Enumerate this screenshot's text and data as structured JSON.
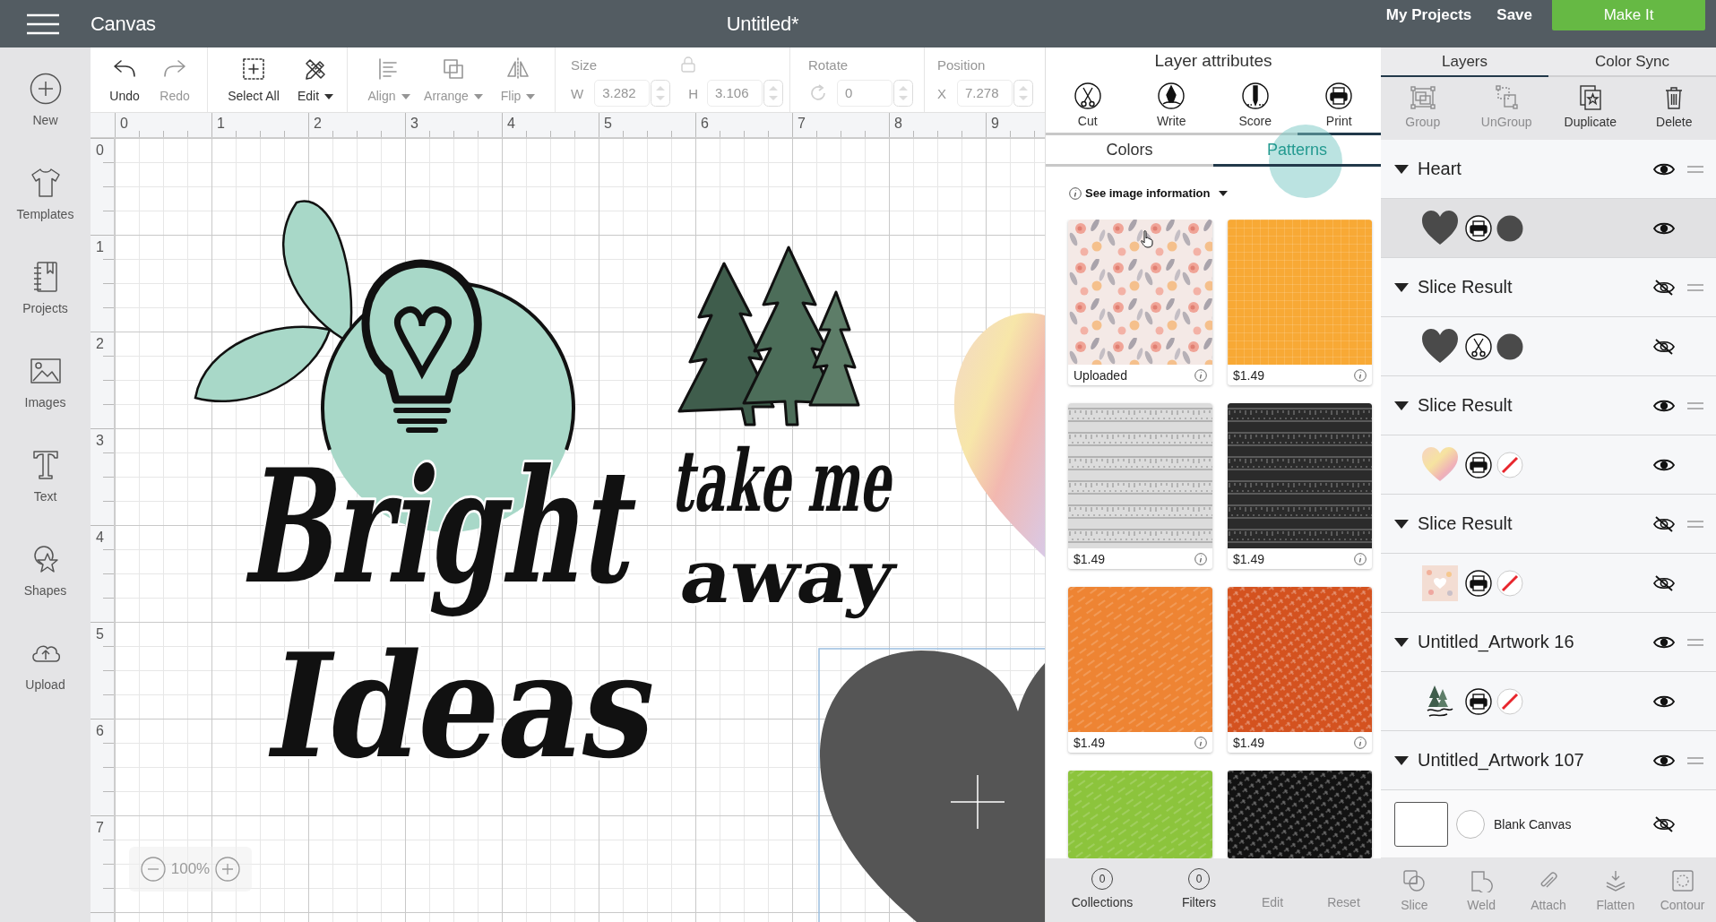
{
  "top_bar": {
    "app_title": "Canvas",
    "document_title": "Untitled*",
    "links": [
      "My Projects",
      "Save"
    ],
    "primary_button": "Make It"
  },
  "sidebar": {
    "items": [
      {
        "label": "New"
      },
      {
        "label": "Templates"
      },
      {
        "label": "Projects"
      },
      {
        "label": "Images"
      },
      {
        "label": "Text"
      },
      {
        "label": "Shapes"
      },
      {
        "label": "Upload"
      }
    ]
  },
  "toolbar": {
    "groups": [
      {
        "buttons": [
          {
            "label": "Undo",
            "disabled": false,
            "dropdown": false
          },
          {
            "label": "Redo",
            "disabled": true,
            "dropdown": false
          }
        ]
      },
      {
        "buttons": [
          {
            "label": "Select All",
            "disabled": false,
            "dropdown": false
          },
          {
            "label": "Edit",
            "disabled": false,
            "dropdown": true
          }
        ]
      },
      {
        "buttons": [
          {
            "label": "Align",
            "disabled": true,
            "dropdown": true
          },
          {
            "label": "Arrange",
            "disabled": true,
            "dropdown": true
          },
          {
            "label": "Flip",
            "disabled": true,
            "dropdown": true
          }
        ]
      }
    ],
    "size": {
      "label": "Size",
      "disabled": true,
      "fields": [
        {
          "label": "W",
          "value": "3.282"
        },
        {
          "label": "H",
          "value": "3.106"
        }
      ]
    },
    "rotate": {
      "label": "Rotate",
      "disabled": true,
      "value": "0"
    },
    "position": {
      "label": "Position",
      "disabled": true,
      "fields": [
        {
          "label": "X",
          "value": "7.278"
        }
      ]
    }
  },
  "ruler": {
    "x_labels": [
      "0",
      "1",
      "2",
      "3",
      "4",
      "5",
      "6",
      "7",
      "8",
      "9"
    ],
    "y_labels": [
      "0",
      "1",
      "2",
      "3",
      "4",
      "5",
      "6",
      "7"
    ]
  },
  "canvas": {
    "objects": [
      {
        "kind": "watercolor-heart",
        "selected": false
      },
      {
        "kind": "heart",
        "selected": true
      },
      {
        "kind": "bulb-lettering",
        "lines": [
          "Bright",
          "Ideas"
        ],
        "selected": false
      },
      {
        "kind": "trees-lettering",
        "lines": [
          "take me",
          "away"
        ],
        "selected": false
      }
    ],
    "zoom": {
      "value": "100%",
      "disabled": true
    }
  },
  "layer_attributes": {
    "title": "Layer attributes",
    "operations": [
      {
        "label": "Cut",
        "selected": false
      },
      {
        "label": "Write",
        "selected": false
      },
      {
        "label": "Score",
        "selected": false
      },
      {
        "label": "Print",
        "selected": true
      }
    ],
    "tabs": [
      {
        "label": "Colors",
        "selected": false
      },
      {
        "label": "Patterns",
        "selected": true
      }
    ],
    "info_link": "See image information",
    "patterns": [
      {
        "kind": "floral",
        "color": "#f4e9e6",
        "label": "Uploaded"
      },
      {
        "kind": "grain",
        "color": "#f8a935",
        "label": "$1.49"
      },
      {
        "kind": "ruler",
        "color": "#dcdcdc",
        "label": "$1.49"
      },
      {
        "kind": "ruler",
        "color": "#2b2b2b",
        "label": "$1.49"
      },
      {
        "kind": "streaks",
        "color": "#ee8433",
        "label": "$1.49"
      },
      {
        "kind": "crosshatch",
        "color": "#d4521f",
        "label": "$1.49"
      },
      {
        "kind": "streaks",
        "color": "#8cc43c"
      },
      {
        "kind": "crosshatch",
        "color": "#121212"
      }
    ],
    "footer": [
      {
        "label": "Collections",
        "count": "0",
        "disabled": false
      },
      {
        "label": "Filters",
        "count": "0",
        "disabled": false
      },
      {
        "label": "Edit",
        "disabled": true
      },
      {
        "label": "Reset",
        "disabled": true
      }
    ]
  },
  "layers_panel": {
    "tabs": [
      {
        "label": "Layers",
        "selected": true
      },
      {
        "label": "Color Sync",
        "selected": false
      }
    ],
    "actions": [
      {
        "label": "Group",
        "disabled": true
      },
      {
        "label": "UnGroup",
        "disabled": true
      },
      {
        "label": "Duplicate",
        "disabled": false
      },
      {
        "label": "Delete",
        "disabled": false
      }
    ],
    "layers": [
      {
        "name": "Heart",
        "expanded": true,
        "visible": true,
        "children": [
          {
            "thumbnail": {
              "kind": "heart"
            },
            "operation": {
              "kind": "print"
            },
            "color": "#4a4a4a",
            "visible": true,
            "selected": true
          }
        ]
      },
      {
        "name": "Slice Result",
        "expanded": true,
        "visible": false,
        "children": [
          {
            "thumbnail": {
              "kind": "heart"
            },
            "operation": {
              "kind": "cut"
            },
            "color": "#4a4a4a",
            "visible": false,
            "selected": false
          }
        ]
      },
      {
        "name": "Slice Result",
        "expanded": true,
        "visible": true,
        "children": [
          {
            "thumbnail": {
              "kind": "watercolor-heart"
            },
            "operation": {
              "kind": "print"
            },
            "visible": true,
            "selected": false
          }
        ]
      },
      {
        "name": "Slice Result",
        "expanded": true,
        "visible": false,
        "children": [
          {
            "thumbnail": {
              "kind": "pattern-square"
            },
            "operation": {
              "kind": "print"
            },
            "visible": false,
            "selected": false
          }
        ]
      },
      {
        "name": "Untitled_Artwork 16",
        "expanded": true,
        "visible": true,
        "children": [
          {
            "thumbnail": {
              "kind": "artwork"
            },
            "operation": {
              "kind": "print"
            },
            "visible": true,
            "selected": false
          }
        ]
      },
      {
        "name": "Untitled_Artwork 107",
        "expanded": true,
        "visible": true
      }
    ],
    "canvas_layer": {
      "label": "Blank Canvas",
      "visible": false
    },
    "tools": [
      {
        "label": "Slice",
        "disabled": true
      },
      {
        "label": "Weld",
        "disabled": true
      },
      {
        "label": "Attach",
        "disabled": true
      },
      {
        "label": "Flatten",
        "disabled": true
      },
      {
        "label": "Contour",
        "disabled": true
      }
    ]
  }
}
